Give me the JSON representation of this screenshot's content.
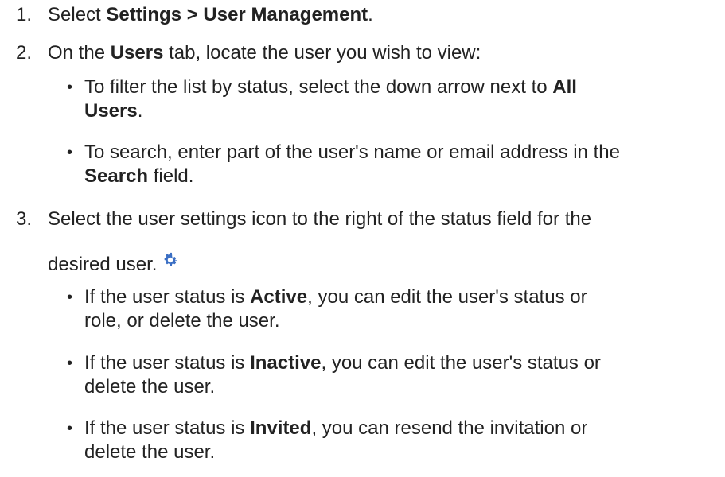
{
  "steps": [
    {
      "number": "1.",
      "prefix": "Select ",
      "bold": "Settings > User Management",
      "suffix": "."
    },
    {
      "number": "2.",
      "prefix": "On the ",
      "bold": "Users",
      "suffix": " tab, locate the user you wish to view:",
      "bullets": [
        {
          "line1_prefix": "To filter the list by status, select the down arrow next to ",
          "line1_bold": "All",
          "line2_bold": "Users",
          "line2_suffix": "."
        },
        {
          "line1_prefix": "To search, enter part of the user's name or email address in the",
          "line2_bold": "Search",
          "line2_suffix": " field."
        }
      ]
    },
    {
      "number": "3.",
      "line1": "Select the user settings icon to the right of the status field for the",
      "line2": "desired user.",
      "icon": "gear-icon",
      "icon_color": "#3b6fc4",
      "bullets": [
        {
          "prefix": "If the user status is ",
          "bold": "Active",
          "suffix": ", you can edit the user's status or",
          "line2": "role, or delete the user."
        },
        {
          "prefix": "If the user status is ",
          "bold": "Inactive",
          "suffix": ", you can edit the user's status or",
          "line2": "delete the user."
        },
        {
          "prefix": "If the user status is ",
          "bold": "Invited",
          "suffix": ", you can resend the invitation or",
          "line2": "delete the user."
        }
      ]
    }
  ]
}
